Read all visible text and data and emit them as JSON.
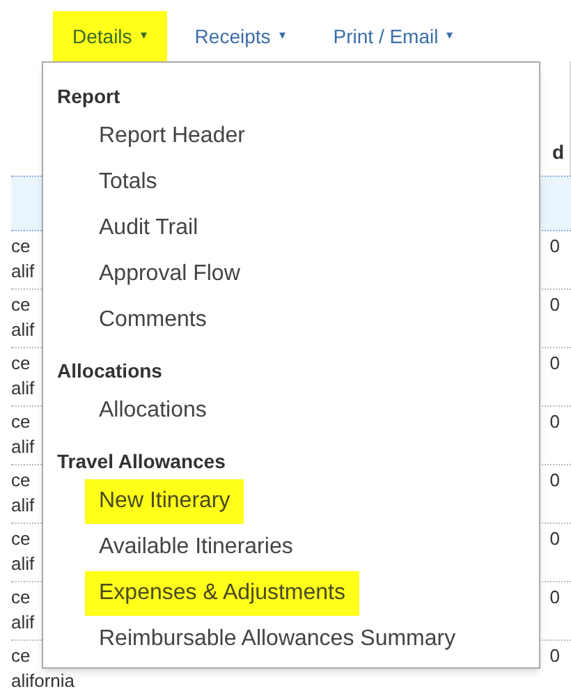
{
  "nav": [
    {
      "label": "Details",
      "caret": "▾",
      "highlighted": true
    },
    {
      "label": "Receipts",
      "caret": "▾",
      "highlighted": false
    },
    {
      "label": "Print / Email",
      "caret": "▾",
      "highlighted": false
    }
  ],
  "table": {
    "header_fragment": "d",
    "rows": [
      {
        "column_1_line_1": "ce",
        "column_1_line_2": "alif",
        "column_2": "0"
      },
      {
        "column_1_line_1": "ce",
        "column_1_line_2": "alif",
        "column_2": "0"
      },
      {
        "column_1_line_1": "ce",
        "column_1_line_2": "alif",
        "column_2": "0"
      },
      {
        "column_1_line_1": "ce",
        "column_1_line_2": "alif",
        "column_2": "0"
      },
      {
        "column_1_line_1": "ce",
        "column_1_line_2": "alif",
        "column_2": "0"
      },
      {
        "column_1_line_1": "ce",
        "column_1_line_2": "alif",
        "column_2": "0"
      },
      {
        "column_1_line_1": "ce",
        "column_1_line_2": "alif",
        "column_2": "0"
      },
      {
        "column_1_line_1": "ce",
        "column_1_line_2": "alifornia",
        "column_2": "0"
      }
    ]
  },
  "menu": {
    "sections": [
      {
        "heading": "Report",
        "items": [
          {
            "label": "Report Header",
            "highlighted": false
          },
          {
            "label": "Totals",
            "highlighted": false
          },
          {
            "label": "Audit Trail",
            "highlighted": false
          },
          {
            "label": "Approval Flow",
            "highlighted": false
          },
          {
            "label": "Comments",
            "highlighted": false
          }
        ]
      },
      {
        "heading": "Allocations",
        "items": [
          {
            "label": "Allocations",
            "highlighted": false
          }
        ]
      },
      {
        "heading": "Travel Allowances",
        "items": [
          {
            "label": "New Itinerary",
            "highlighted": true
          },
          {
            "label": "Available Itineraries",
            "highlighted": false
          },
          {
            "label": "Expenses & Adjustments",
            "highlighted": true
          },
          {
            "label": "Reimbursable Allowances Summary",
            "highlighted": false
          }
        ]
      }
    ]
  }
}
